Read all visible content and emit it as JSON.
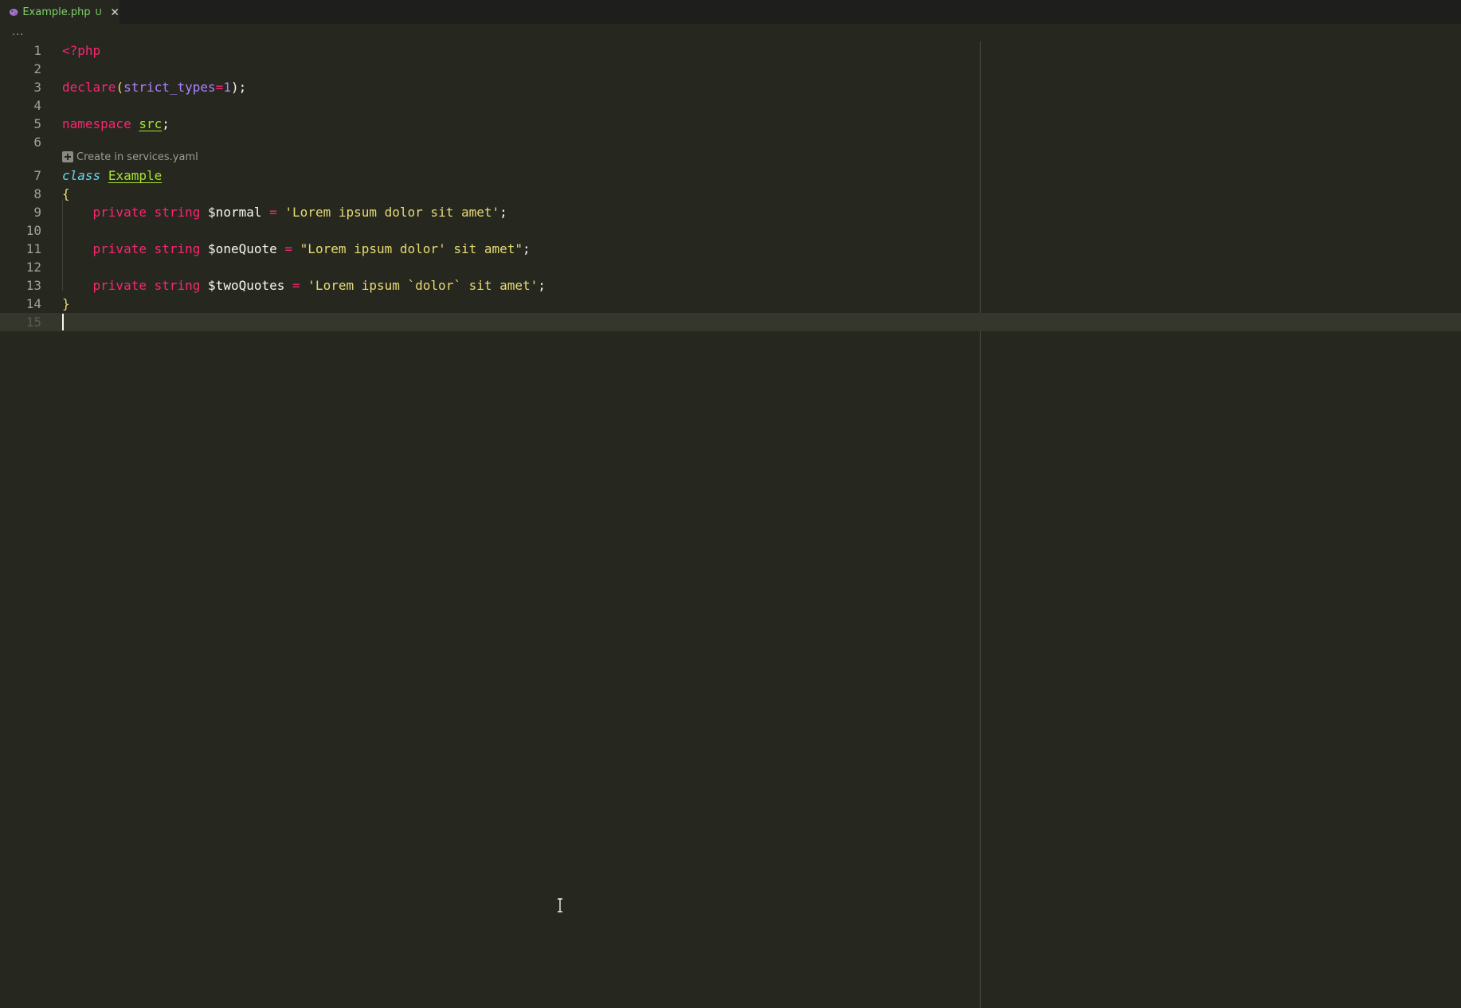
{
  "tab": {
    "title": "Example.php",
    "status": "U",
    "icon": "php-elephant-icon"
  },
  "breadcrumb": "...",
  "codelens": {
    "label": "Create in services.yaml",
    "icon": "plus-icon"
  },
  "lines": [
    {
      "n": "1"
    },
    {
      "n": "2"
    },
    {
      "n": "3"
    },
    {
      "n": "4"
    },
    {
      "n": "5"
    },
    {
      "n": "6"
    },
    {
      "n": "7"
    },
    {
      "n": "8"
    },
    {
      "n": "9"
    },
    {
      "n": "10"
    },
    {
      "n": "11"
    },
    {
      "n": "12"
    },
    {
      "n": "13"
    },
    {
      "n": "14"
    },
    {
      "n": "15"
    }
  ],
  "code": {
    "l1": {
      "open": "<?php"
    },
    "l3": {
      "fn": "declare",
      "p1": "(",
      "arg": "strict_types",
      "eq": "=",
      "num": "1",
      "p2": ");"
    },
    "l5": {
      "kw": "namespace",
      "ns": "src",
      "semi": ";"
    },
    "l7": {
      "kw": "class",
      "name": "Example"
    },
    "l8": {
      "brace": "{"
    },
    "l9": {
      "mod": "private",
      "type": "string",
      "var": "$normal",
      "eq": "=",
      "str": "'Lorem ipsum dolor sit amet'",
      "semi": ";"
    },
    "l11": {
      "mod": "private",
      "type": "string",
      "var": "$oneQuote",
      "eq": "=",
      "str": "\"Lorem ipsum dolor' sit amet\"",
      "semi": ";"
    },
    "l13": {
      "mod": "private",
      "type": "string",
      "var": "$twoQuotes",
      "eq": "=",
      "str": "'Lorem ipsum `dolor` sit amet'",
      "semi": ";"
    },
    "l14": {
      "brace": "}"
    }
  },
  "colors": {
    "background": "#262820",
    "keyword": "#f92672",
    "string": "#e6db74",
    "number": "#ae81ff",
    "class_name": "#a6e22e",
    "storage": "#66d9ef",
    "tab_title": "#7fd06a"
  }
}
